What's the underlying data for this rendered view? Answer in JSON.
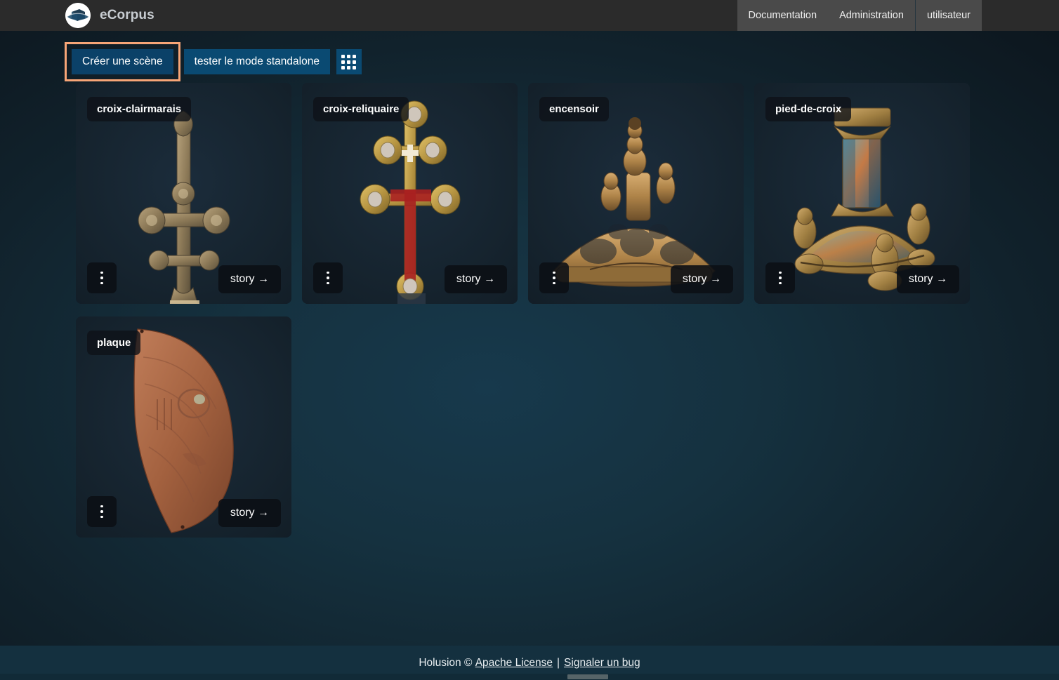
{
  "header": {
    "brand": "eCorpus",
    "logo_icon": "ecorpus-logo-icon",
    "nav": [
      {
        "label": "Documentation",
        "name": "documentation"
      },
      {
        "label": "Administration",
        "name": "administration"
      },
      {
        "label": "utilisateur",
        "name": "utilisateur"
      }
    ]
  },
  "toolbar": {
    "create_scene_label": "Créer une scène",
    "standalone_label": "tester le mode standalone",
    "grid_icon": "grid-view-icon",
    "focus_highlight_color": "#f7a577",
    "button_color": "#0a4a72"
  },
  "scenes": [
    {
      "title": "croix-clairmarais",
      "story_label": "story →",
      "menu_icon": "kebab-menu-icon",
      "art": "cross-clairmarais"
    },
    {
      "title": "croix-reliquaire",
      "story_label": "story →",
      "menu_icon": "kebab-menu-icon",
      "art": "cross-reliquary"
    },
    {
      "title": "encensoir",
      "story_label": "story →",
      "menu_icon": "kebab-menu-icon",
      "art": "censer"
    },
    {
      "title": "pied-de-croix",
      "story_label": "story →",
      "menu_icon": "kebab-menu-icon",
      "art": "cross-foot"
    },
    {
      "title": "plaque",
      "story_label": "story →",
      "menu_icon": "kebab-menu-icon",
      "art": "plaque"
    }
  ],
  "footer": {
    "copyright": "Holusion ©",
    "license_link": "Apache License",
    "separator": "|",
    "bug_link": "Signaler un bug"
  }
}
